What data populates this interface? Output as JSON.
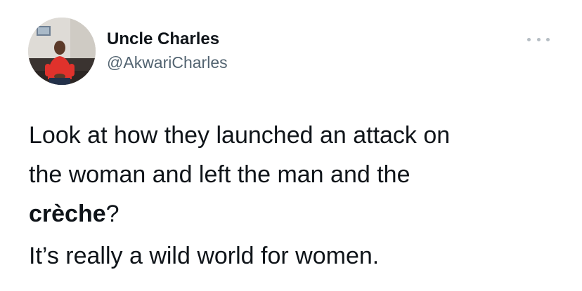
{
  "tweet": {
    "author": {
      "display_name": "Uncle Charles",
      "handle": "@AkwariCharles"
    },
    "more_menu_icon": "ellipsis-icon",
    "text": {
      "line1": "Look at how they launched an attack on",
      "line2": "the woman and left the man and the",
      "bold_word": "crèche",
      "after_bold": "?",
      "paragraph2": "It’s really a wild world for women."
    }
  },
  "colors": {
    "text_primary": "#0f1419",
    "text_secondary": "#536471",
    "more_dots": "#b6bec4",
    "avatar_shirt": "#e0322c"
  }
}
